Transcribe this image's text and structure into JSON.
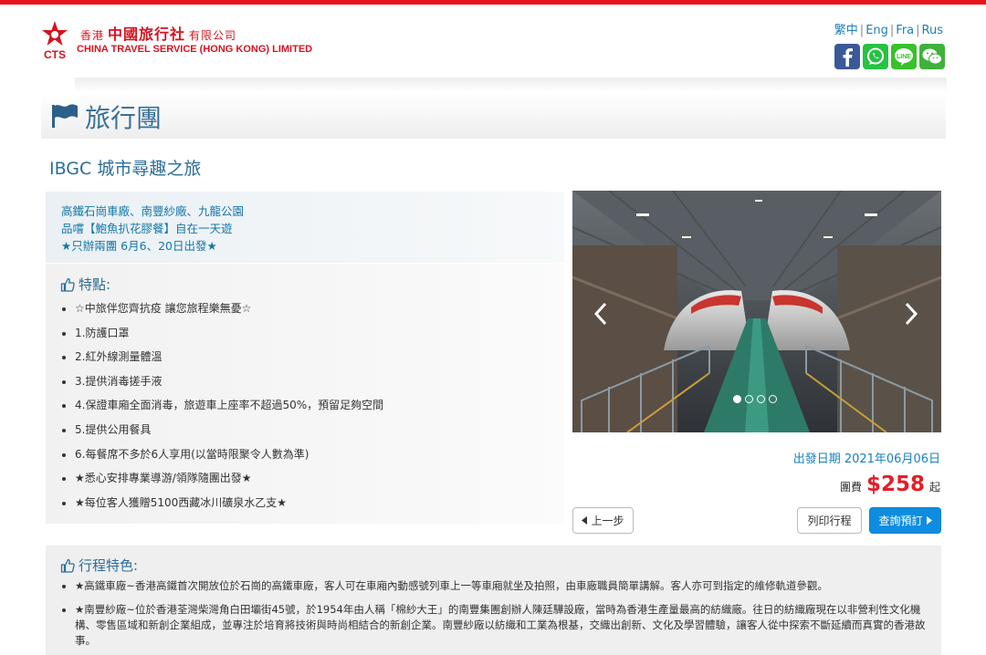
{
  "colors": {
    "accent_red": "#e8141c",
    "link_blue": "#1a7fba",
    "title_blue": "#2c6d97",
    "button_blue": "#0e8de0",
    "price_red": "#e41e26"
  },
  "header": {
    "logo": {
      "mark_text": "CTS",
      "region": "香港",
      "brand": "中國旅行社",
      "suffix": "有限公司",
      "english": "CHINA TRAVEL SERVICE (HONG KONG) LIMITED"
    },
    "languages": [
      "繁中",
      "Eng",
      "Fra",
      "Rus"
    ],
    "social": [
      {
        "name": "facebook",
        "icon": "facebook-icon"
      },
      {
        "name": "whatsapp",
        "icon": "whatsapp-icon"
      },
      {
        "name": "line",
        "icon": "line-icon"
      },
      {
        "name": "wechat",
        "icon": "wechat-icon"
      }
    ]
  },
  "page": {
    "title": "旅行團",
    "icon": "flag-icon"
  },
  "tour": {
    "title": "IBGC 城市尋趣之旅",
    "summary": [
      "高鐵石崗車廠、南豐紗廠、九龍公園",
      "品嚐【鮑魚扒花膠餐】自在一天遊",
      "★只辦兩團 6月6、20日出發★"
    ],
    "features_heading": "特點:",
    "features": [
      "☆中旅伴您齊抗疫 讓您旅程樂無憂☆",
      "1.防護口罩",
      "2.紅外線測量體溫",
      "3.提供消毒搓手液",
      "4.保證車廂全面消毒，旅遊車上座率不超過50%，預留足夠空間",
      "5.提供公用餐具",
      "6.每餐席不多於6人享用(以當時限聚令人數為準)",
      "★悉心安排專業導游/領隊隨團出發★",
      "★每位客人獲贈5100西藏冰川礦泉水乙支★"
    ],
    "carousel": {
      "slide_count": 4,
      "active_index": 0
    },
    "departure": "出發日期 2021年06月06日",
    "price": {
      "label": "團費",
      "value": "$258",
      "suffix": "起"
    },
    "buttons": {
      "prev": "上一步",
      "print": "列印行程",
      "enquire": "查詢預訂"
    },
    "itinerary_heading": "行程特色:",
    "itinerary": [
      "★高鐵車廠~香港高鐵首次開放位於石崗的高鐵車廠，客人可在車廂內動感號列車上一等車廂就坐及拍照，由車廠職員簡單講解。客人亦可到指定的維修軌道參觀。",
      "★南豐紗廠~位於香港荃灣柴灣角白田壩街45號，於1954年由人稱「棉紗大王」的南豐集團創辦人陳廷驊設廠，當時為香港生產量最高的紡織廠。往日的紡織廠現在以非營利性文化機構、零售區域和新創企業組成，並專注於培育將技術與時尚相結合的新創企業。南豐紗廠以紡織和工業為根基，交織出創新、文化及學習體驗，讓客人從中探索不斷延續而真實的香港故事。"
    ]
  }
}
